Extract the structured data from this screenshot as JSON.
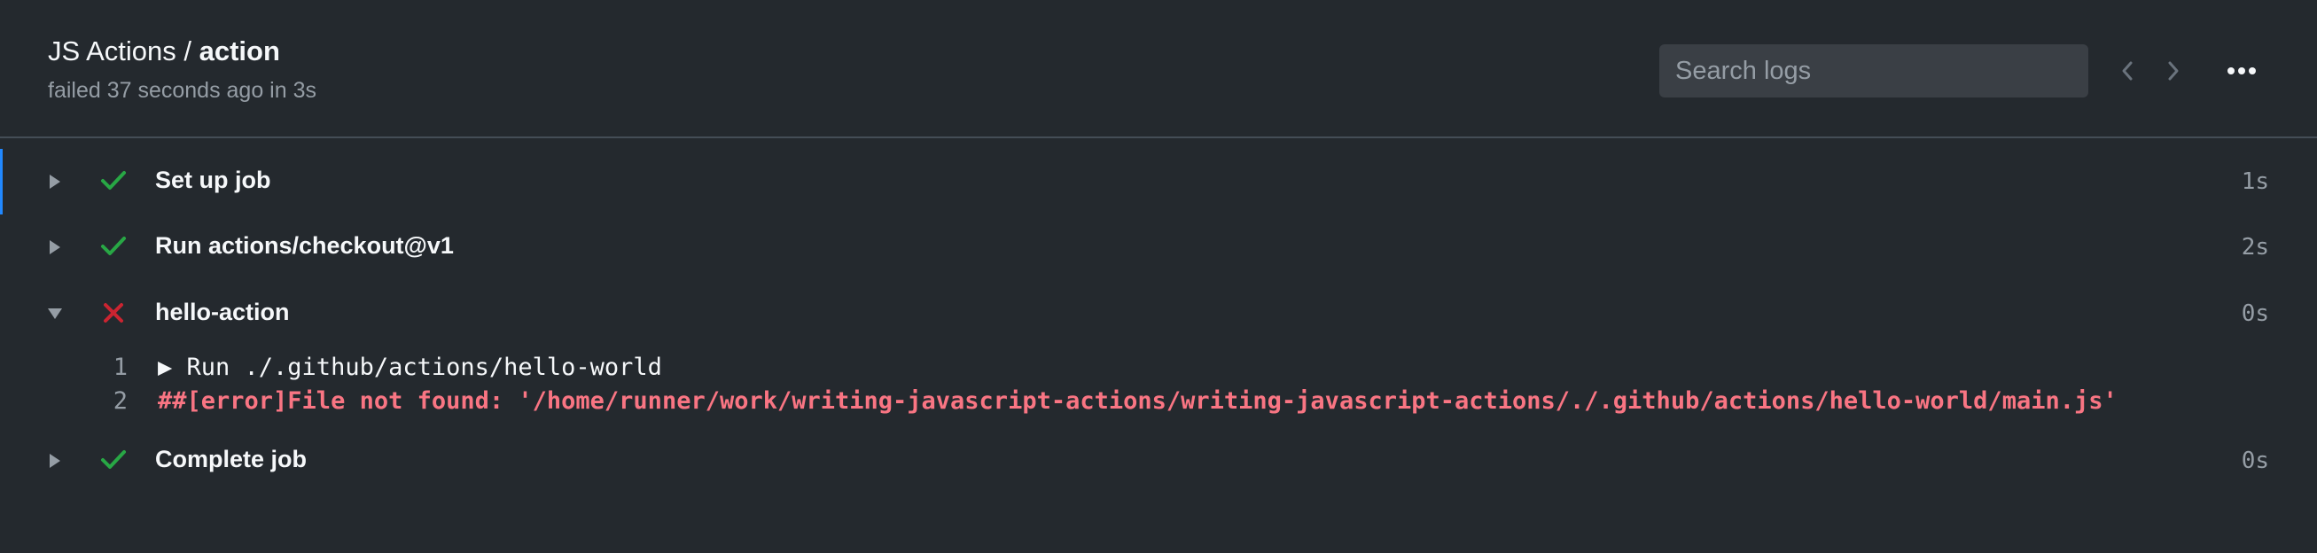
{
  "header": {
    "workflow_name": "JS Actions /",
    "job_name": "action",
    "status_text": "failed 37 seconds ago in 3s",
    "search_placeholder": "Search logs"
  },
  "colors": {
    "background": "#24292e",
    "success": "#28a745",
    "failure": "#cb2431",
    "error_text": "#f97583",
    "active_indicator": "#2188ff"
  },
  "steps": [
    {
      "name": "Set up job",
      "duration": "1s",
      "status": "success",
      "expanded": false
    },
    {
      "name": "Run actions/checkout@v1",
      "duration": "2s",
      "status": "success",
      "expanded": false
    },
    {
      "name": "hello-action",
      "duration": "0s",
      "status": "failure",
      "expanded": true
    },
    {
      "name": "Complete job",
      "duration": "0s",
      "status": "success",
      "expanded": false
    }
  ],
  "log": [
    {
      "number": "1",
      "text": "▶ Run ./.github/actions/hello-world",
      "is_error": false
    },
    {
      "number": "2",
      "text": "##[error]File not found: '/home/runner/work/writing-javascript-actions/writing-javascript-actions/./.github/actions/hello-world/main.js'",
      "is_error": true
    }
  ],
  "icons": {
    "prev": "chevron-left-icon",
    "next": "chevron-right-icon",
    "more": "kebab-horizontal-icon",
    "collapsed": "triangle-right-icon",
    "expanded": "triangle-down-icon",
    "success": "check-icon",
    "failure": "x-icon"
  }
}
